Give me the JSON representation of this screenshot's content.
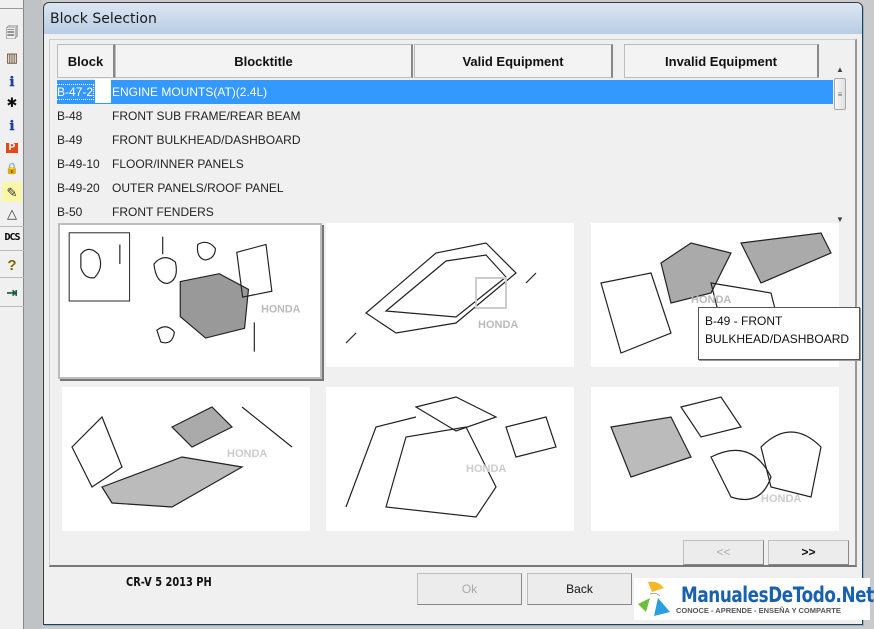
{
  "toolbar": {
    "items": [
      {
        "name": "copy-pages-icon",
        "glyph": "🗐"
      },
      {
        "name": "catalog-icon",
        "glyph": "▥"
      },
      {
        "name": "info-person-icon",
        "glyph": "ℹ"
      },
      {
        "name": "magic-hat-icon",
        "glyph": "✱"
      },
      {
        "name": "info-car-icon",
        "glyph": "ℹ"
      },
      {
        "name": "parts-car-icon",
        "glyph": "P"
      },
      {
        "name": "lock-document-icon",
        "glyph": "🔒"
      },
      {
        "name": "wrench-tool-icon",
        "glyph": "✎"
      },
      {
        "name": "drafting-icon",
        "glyph": "△"
      },
      {
        "name": "dcs-icon",
        "glyph": "DCS"
      },
      {
        "name": "help-icon",
        "glyph": "?"
      },
      {
        "name": "exit-icon",
        "glyph": "⇥"
      }
    ]
  },
  "dialog": {
    "title": "Block Selection",
    "table": {
      "columns": [
        "Block",
        "Blocktitle",
        "Valid Equipment",
        "Invalid Equipment"
      ],
      "rows": [
        {
          "block": "B-47-2",
          "title": "ENGINE MOUNTS(AT)(2.4L)",
          "selected": true
        },
        {
          "block": "B-48",
          "title": "FRONT SUB FRAME/REAR BEAM",
          "selected": false
        },
        {
          "block": "B-49",
          "title": "FRONT BULKHEAD/DASHBOARD",
          "selected": false
        },
        {
          "block": "B-49-10",
          "title": "FLOOR/INNER PANELS",
          "selected": false
        },
        {
          "block": "B-49-20",
          "title": "OUTER PANELS/ROOF PANEL",
          "selected": false
        },
        {
          "block": "B-50",
          "title": "FRONT FENDERS",
          "selected": false
        }
      ]
    },
    "thumbnails": [
      {
        "block": "B-47-2",
        "label": "Engine mounts diagram",
        "brand": "HONDA"
      },
      {
        "block": "B-48",
        "label": "Front sub frame diagram",
        "brand": "HONDA"
      },
      {
        "block": "B-49",
        "label": "Front bulkhead diagram",
        "brand": "HONDA"
      },
      {
        "block": "B-49-10",
        "label": "Floor inner panels diagram",
        "brand": "HONDA"
      },
      {
        "block": "B-49-20",
        "label": "Outer panels roof diagram",
        "brand": "HONDA"
      },
      {
        "block": "B-50",
        "label": "Front fenders diagram",
        "brand": "HONDA"
      }
    ],
    "tooltip": {
      "line1": "B-49 - FRONT",
      "line2": "BULKHEAD/DASHBOARD"
    },
    "pager": {
      "prev": "<<",
      "next": ">>"
    },
    "footer": {
      "vehicle": "CR-V  5  2013  PH",
      "ok_label": "Ok",
      "back_label": "Back"
    }
  },
  "watermark": {
    "title": "ManualesDeTodo.Net",
    "subtitle": "CONOCE - APRENDE - ENSEÑA Y COMPARTE"
  }
}
